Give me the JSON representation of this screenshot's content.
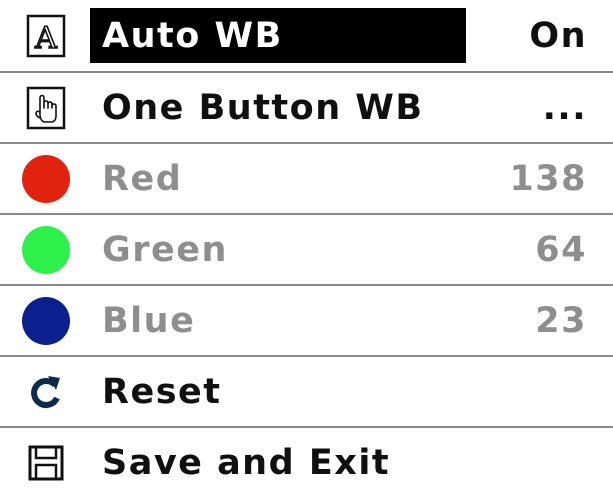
{
  "menu": {
    "items": [
      {
        "label": "Auto WB",
        "value": "On",
        "icon": "auto-letter-icon",
        "selected": true,
        "enabled": true
      },
      {
        "label": "One Button WB",
        "value": "...",
        "icon": "hand-pointer-icon",
        "selected": false,
        "enabled": true
      },
      {
        "label": "Red",
        "value": "138",
        "icon": "red-dot-icon",
        "color": "#e0220e",
        "selected": false,
        "enabled": false
      },
      {
        "label": "Green",
        "value": "64",
        "icon": "green-dot-icon",
        "color": "#2ef04a",
        "selected": false,
        "enabled": false
      },
      {
        "label": "Blue",
        "value": "23",
        "icon": "blue-dot-icon",
        "color": "#0b1f8e",
        "selected": false,
        "enabled": false
      },
      {
        "label": "Reset",
        "value": "",
        "icon": "reset-arrow-icon",
        "selected": false,
        "enabled": true
      },
      {
        "label": "Save and Exit",
        "value": "",
        "icon": "floppy-disk-icon",
        "selected": false,
        "enabled": true
      }
    ]
  },
  "colors": {
    "highlight": "#000000",
    "text": "#101010",
    "disabled_text": "#8e8e8e",
    "divider": "#8a8a8a"
  }
}
